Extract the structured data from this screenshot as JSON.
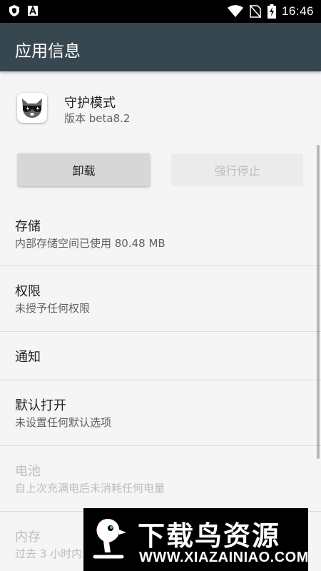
{
  "status_bar": {
    "left_icons": [
      "shield-icon",
      "a-letter-icon"
    ],
    "right_icons": [
      "wifi-icon",
      "no-sim-icon",
      "battery-charging-icon"
    ],
    "time": "16:46",
    "background": "#000000"
  },
  "app_bar": {
    "title": "应用信息",
    "background": "#37474f"
  },
  "app": {
    "name": "守护模式",
    "version": "版本 beta8.2",
    "icon": "raccoon-sunglasses-icon"
  },
  "buttons": {
    "uninstall_label": "卸载",
    "force_stop_label": "强行停止"
  },
  "rows": [
    {
      "title": "存储",
      "subtitle": "内部存储空间已使用 80.48 MB",
      "enabled": true
    },
    {
      "title": "权限",
      "subtitle": "未授予任何权限",
      "enabled": true
    },
    {
      "title": "通知",
      "subtitle": "",
      "enabled": true
    },
    {
      "title": "默认打开",
      "subtitle": "未设置任何默认选项",
      "enabled": true
    },
    {
      "title": "电池",
      "subtitle": "自上次充满电后未消耗任何电量",
      "enabled": false
    },
    {
      "title": "内存",
      "subtitle": "过去 3 小时内",
      "enabled": false
    }
  ],
  "watermark": {
    "title": "下载鸟资源",
    "url": "WWW.XIAZAINIAO.COM"
  }
}
